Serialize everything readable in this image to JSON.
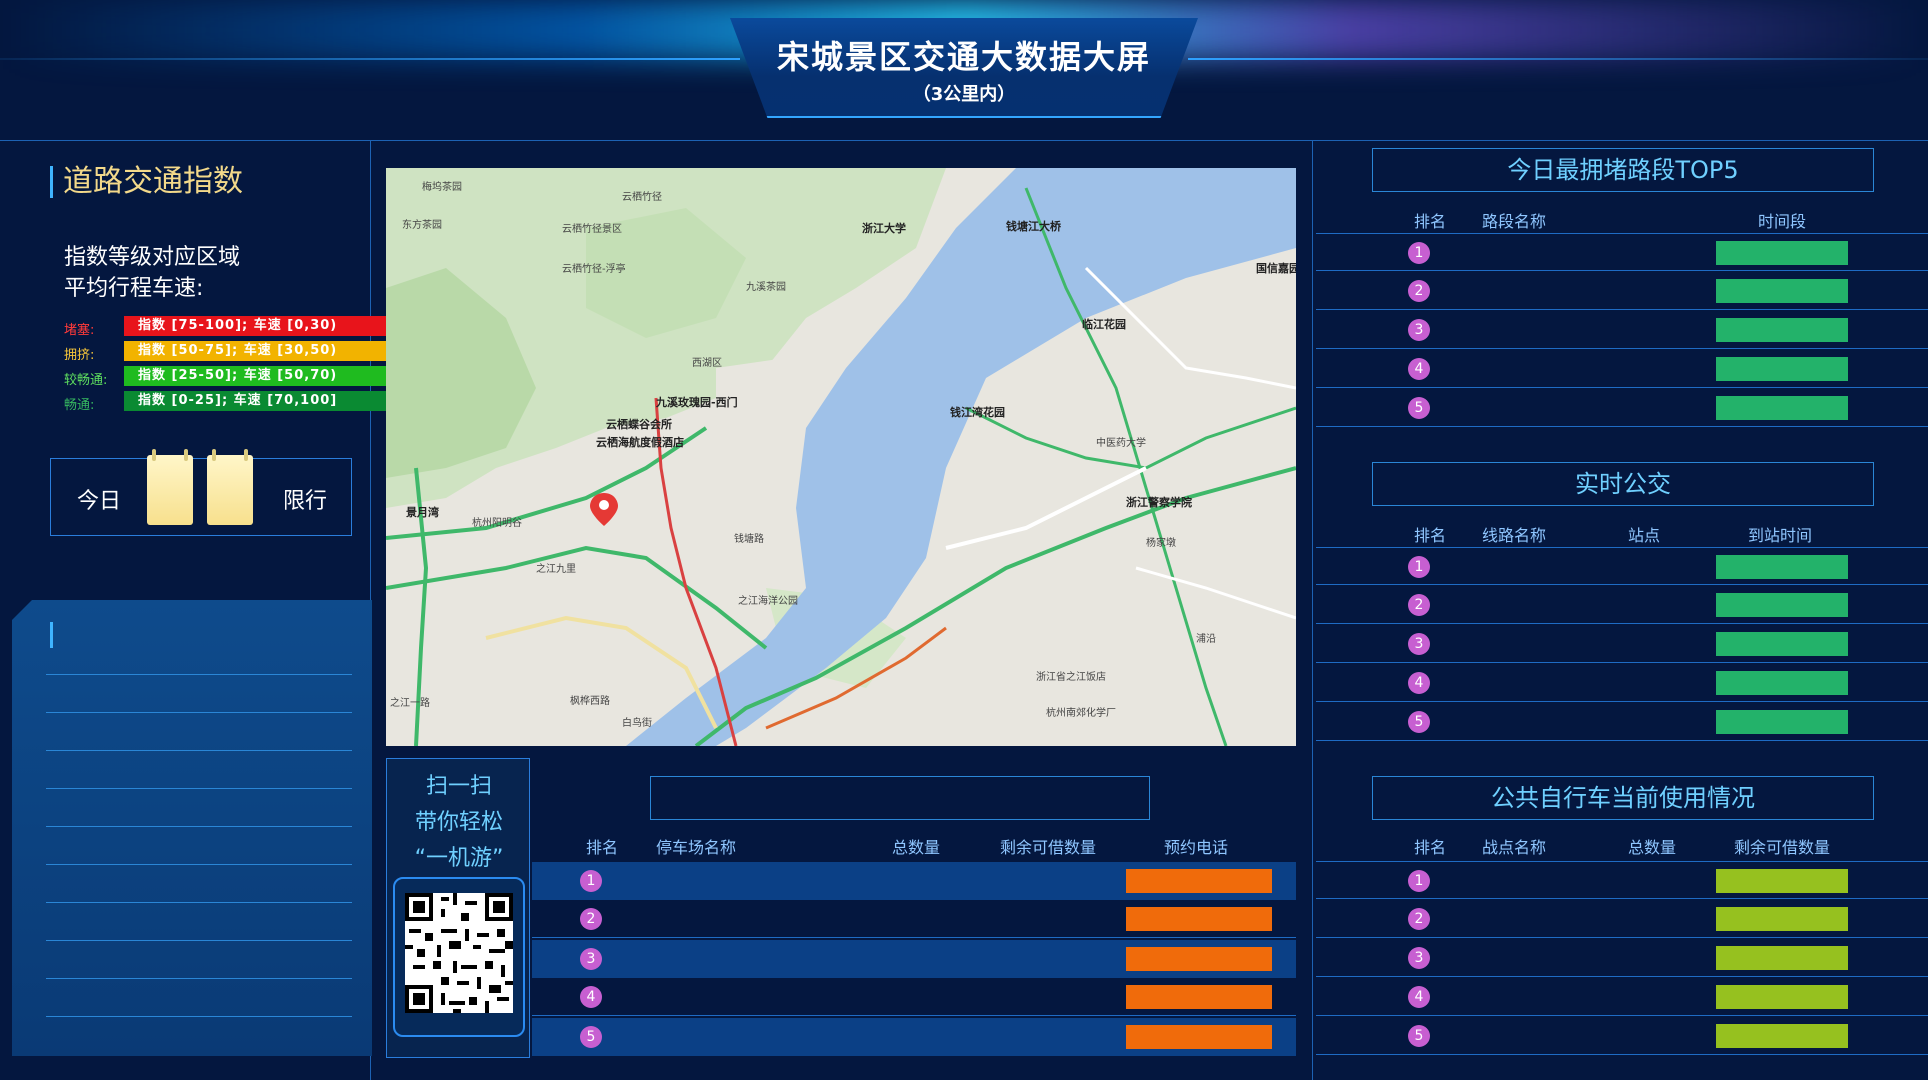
{
  "header": {
    "title": "宋城景区交通大数据大屏",
    "subtitle": "（3公里内）"
  },
  "left": {
    "section_title": "道路交通指数",
    "index_desc_line1": "指数等级对应区域",
    "index_desc_line2": "平均行程车速:",
    "legend": [
      {
        "label": "堵塞:",
        "range": "指数 [75-100]; 车速 [0,30)",
        "color": "#e8141b",
        "label_color": "#ff3a3a"
      },
      {
        "label": "拥挤:",
        "range": "指数 [50-75]; 车速 [30,50)",
        "color": "#f2b300",
        "label_color": "#f7c63a"
      },
      {
        "label": "较畅通:",
        "range": "指数 [25-50]; 车速 [50,70)",
        "color": "#1fbb1f",
        "label_color": "#5fe05f"
      },
      {
        "label": "畅通:",
        "range": "指数 [0-25]; 车速 [70,100]",
        "color": "#0a8a32",
        "label_color": "#36b860"
      }
    ],
    "limit_today": "今日",
    "limit_label": "限行"
  },
  "map": {
    "labels": {
      "l1": "梅坞茶园",
      "l2": "云栖竹径",
      "l3": "云栖竹径景区",
      "l4": "云栖竹径-浮亭",
      "l5": "浙江大学",
      "l6": "钱塘江大桥",
      "l7": "九溪玫瑰园-西门",
      "l8": "云栖蝶谷会所",
      "l9": "云栖海航度假酒店",
      "l10": "景月湾",
      "l11": "杭州阳明谷",
      "l12": "之江九里",
      "l13": "之江海洋公园",
      "l14": "临江花园",
      "l15": "钱江湾花园",
      "l16": "中医药大学",
      "l17": "浙江警察学院",
      "l18": "杨家墩",
      "l19": "浦沿",
      "l20": "浙江省之江饭店",
      "l21": "杭州南郊化学厂",
      "l22": "之江一路",
      "l23": "钱塘路",
      "l24": "枫桦西路",
      "l25": "白鸟街",
      "l26": "国信嘉园",
      "l27": "九溪茶园",
      "l28": "西湖区",
      "l29": "东方茶园"
    }
  },
  "qr": {
    "line1": "扫一扫",
    "line2": "带你轻松",
    "line3": "“一机游”"
  },
  "parking": {
    "headers": {
      "rank": "排名",
      "name": "停车场名称",
      "total": "总数量",
      "remain": "剩余可借数量",
      "phone": "预约电话"
    },
    "rows": [
      "1",
      "2",
      "3",
      "4",
      "5"
    ]
  },
  "congestion": {
    "title": "今日最拥堵路段TOP5",
    "headers": {
      "rank": "排名",
      "name": "路段名称",
      "time": "时间段"
    },
    "rows": [
      "1",
      "2",
      "3",
      "4",
      "5"
    ]
  },
  "bus": {
    "title": "实时公交",
    "headers": {
      "rank": "排名",
      "line": "线路名称",
      "stop": "站点",
      "arrive": "到站时间"
    },
    "rows": [
      "1",
      "2",
      "3",
      "4",
      "5"
    ]
  },
  "bike": {
    "title": "公共自行车当前使用情况",
    "headers": {
      "rank": "排名",
      "name": "战点名称",
      "total": "总数量",
      "remain": "剩余可借数量"
    },
    "rows": [
      "1",
      "2",
      "3",
      "4",
      "5"
    ]
  }
}
